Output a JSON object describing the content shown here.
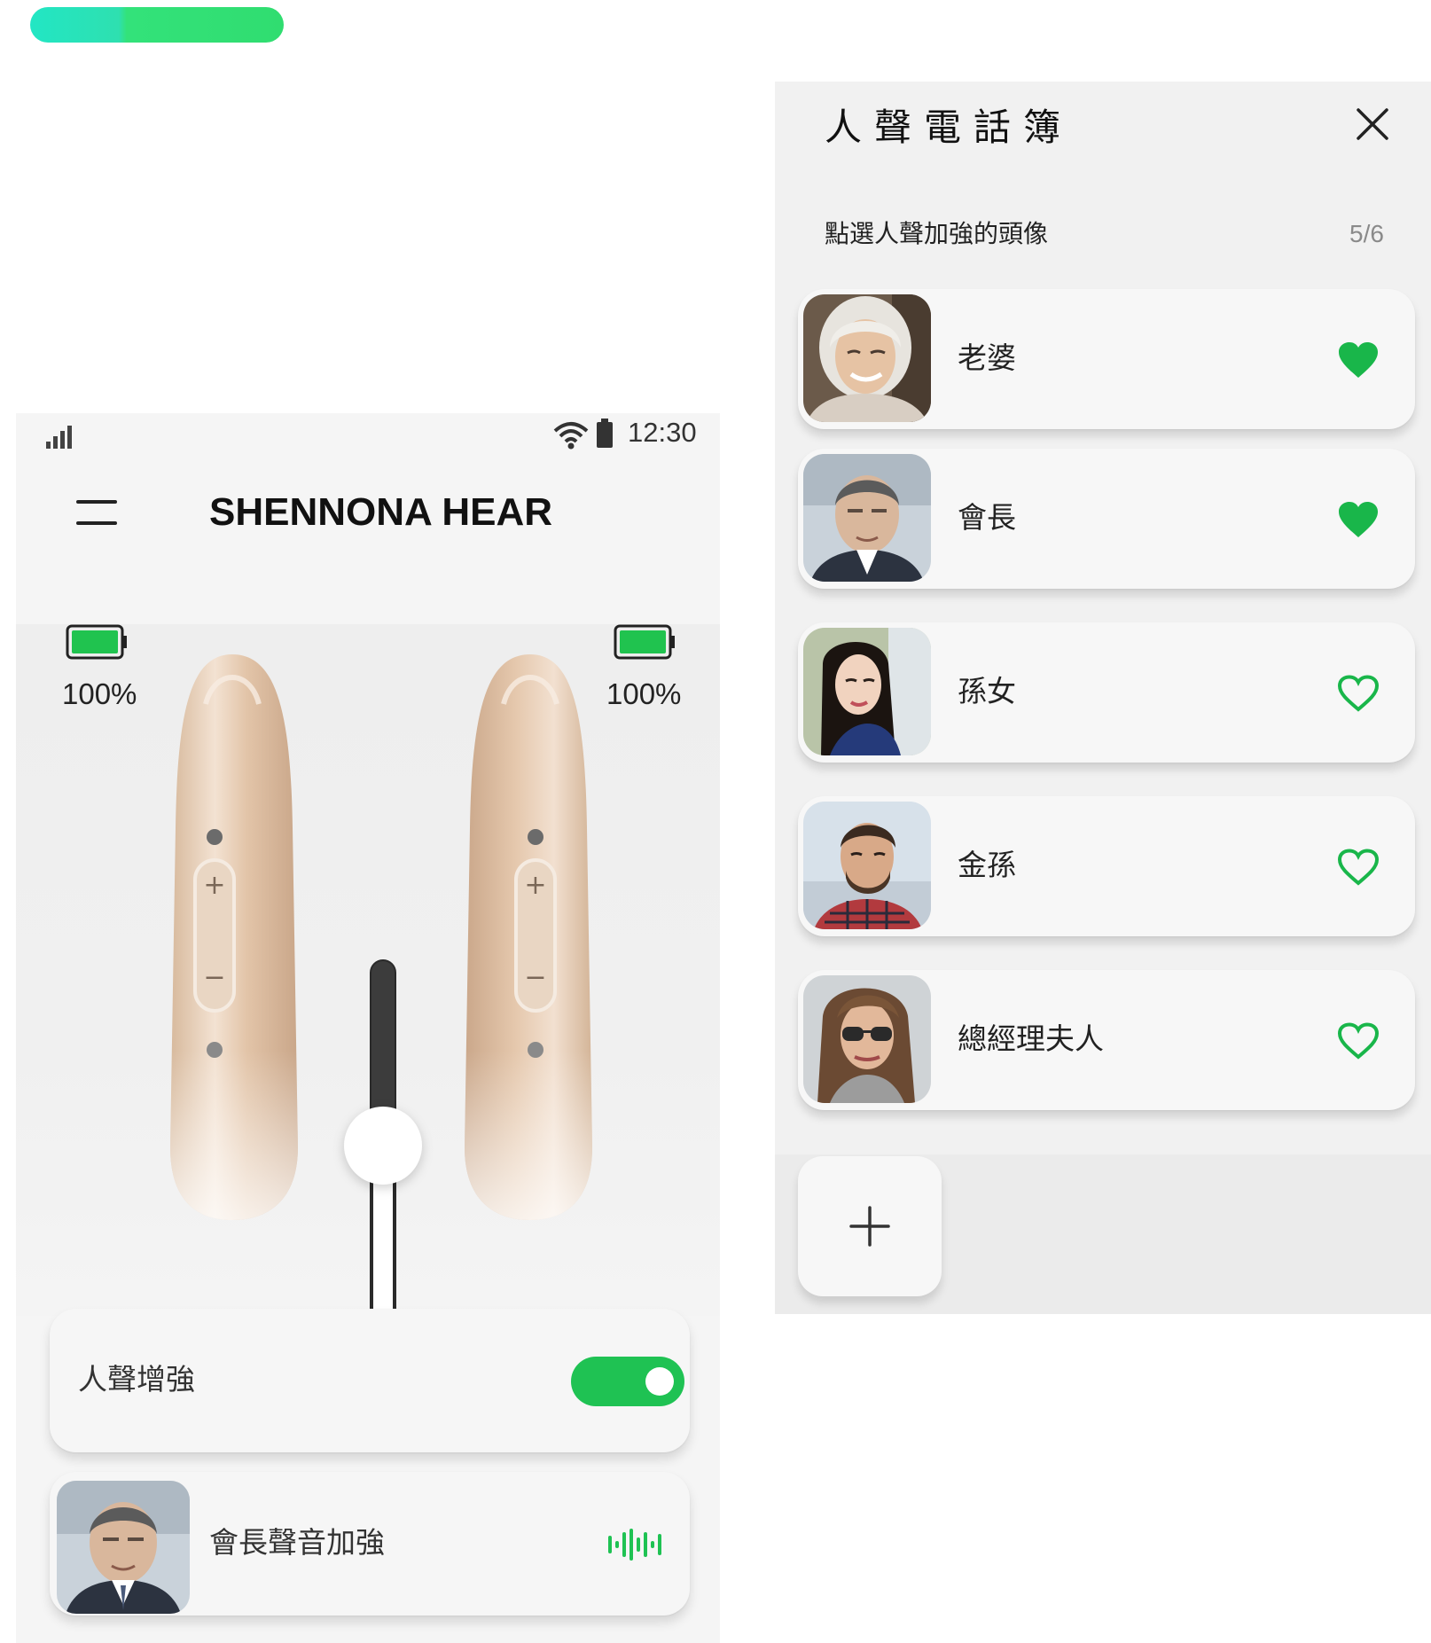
{
  "phone": {
    "status": {
      "time": "12:30"
    },
    "header": {
      "title": "SHENNONA HEAR"
    },
    "devices": {
      "left": {
        "battery_percent": "100%",
        "battery_level": 1.0
      },
      "right": {
        "battery_percent": "100%",
        "battery_level": 1.0
      },
      "aid_plus": "+",
      "aid_minus": "−",
      "volume_level": 0.5
    },
    "voice_enhance": {
      "label": "人聲增強",
      "enabled": true
    },
    "boost": {
      "label": "會長聲音加強"
    }
  },
  "phonebook": {
    "title": "人聲電話簿",
    "subtitle": "點選人聲加強的頭像",
    "count": "5/6",
    "contacts": [
      {
        "name": "老婆",
        "favorite": true
      },
      {
        "name": "會長",
        "favorite": true
      },
      {
        "name": "孫女",
        "favorite": false
      },
      {
        "name": "金孫",
        "favorite": false
      },
      {
        "name": "總經理夫人",
        "favorite": false
      }
    ]
  },
  "colors": {
    "accent_green": "#1fc253",
    "heart_green": "#19b64a",
    "top_pill_teal": "#22e6c4",
    "top_pill_green": "#33e27a"
  }
}
